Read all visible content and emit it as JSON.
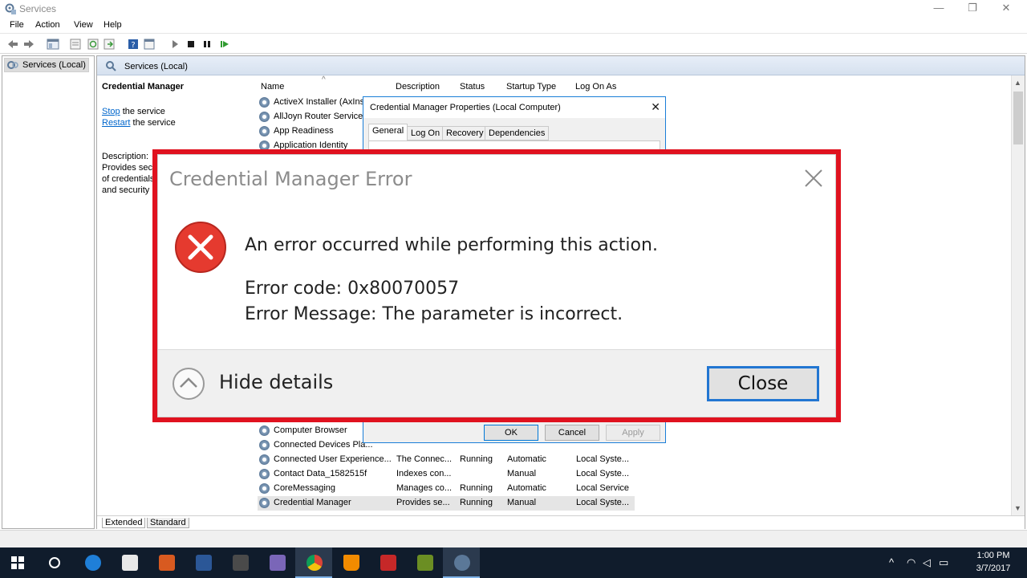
{
  "window": {
    "title": "Services",
    "minimize": "—",
    "restore": "❐",
    "close": "✕"
  },
  "menu": [
    "File",
    "Action",
    "View",
    "Help"
  ],
  "tree": {
    "root_label": "Services (Local)"
  },
  "main": {
    "header_label": "Services (Local)",
    "detail": {
      "service_name": "Credential Manager",
      "stop_link": "Stop",
      "stop_rest": " the service",
      "restart_link": "Restart",
      "restart_rest": " the service",
      "description_label": "Description:",
      "description_lines": [
        "Provides secu",
        "of credentials",
        "and security"
      ]
    },
    "columns": {
      "name": "Name",
      "description": "Description",
      "status": "Status",
      "startup": "Startup Type",
      "logon": "Log On As"
    },
    "rows_top": [
      {
        "name": "ActiveX Installer (AxIns"
      },
      {
        "name": "AllJoyn Router Service"
      },
      {
        "name": "App Readiness"
      },
      {
        "name": "Application Identity"
      }
    ],
    "rows_bottom": [
      {
        "name": "Computer Browser",
        "description": "",
        "status": "",
        "startup": "",
        "logon": ""
      },
      {
        "name": "Connected Devices Pla...",
        "description": "",
        "status": "",
        "startup": "",
        "logon": ""
      },
      {
        "name": "Connected User Experience...",
        "description": "The Connec...",
        "status": "Running",
        "startup": "Automatic",
        "logon": "Local Syste..."
      },
      {
        "name": "Contact Data_1582515f",
        "description": "Indexes con...",
        "status": "",
        "startup": "Manual",
        "logon": "Local Syste..."
      },
      {
        "name": "CoreMessaging",
        "description": "Manages co...",
        "status": "Running",
        "startup": "Automatic",
        "logon": "Local Service"
      },
      {
        "name": "Credential Manager",
        "description": "Provides se...",
        "status": "Running",
        "startup": "Manual",
        "logon": "Local Syste..."
      }
    ],
    "view_tabs": [
      "Extended",
      "Standard"
    ]
  },
  "properties_dialog": {
    "title": "Credential Manager Properties (Local Computer)",
    "tabs": [
      "General",
      "Log On",
      "Recovery",
      "Dependencies"
    ],
    "ok": "OK",
    "cancel": "Cancel",
    "apply": "Apply"
  },
  "error_dialog": {
    "title": "Credential Manager Error",
    "message": "An error occurred while performing this action.",
    "error_code": "Error code: 0x80070057",
    "error_message": "Error Message: The parameter is incorrect.",
    "hide_details": "Hide details",
    "close_button": "Close",
    "highlight_color": "#e0121f"
  },
  "taskbar": {
    "time": "1:00 PM",
    "date": "3/7/2017"
  }
}
